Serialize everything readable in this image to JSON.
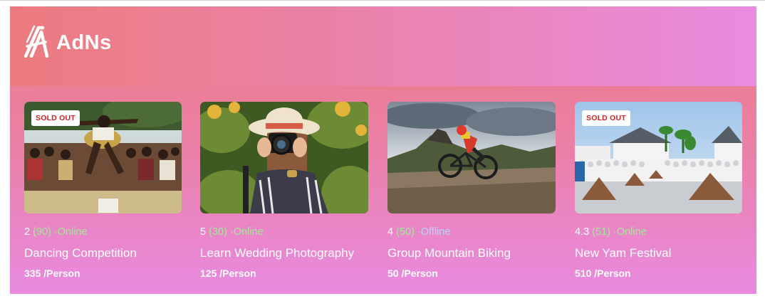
{
  "brand": {
    "name": "AdNs",
    "logo_icon": "a-logo-icon"
  },
  "badge_text": "SOLD OUT",
  "cards": [
    {
      "rating": "2",
      "count": "(90)",
      "status": "·Online",
      "title": "Dancing Competition",
      "price": "335 /Person",
      "sold_out": true,
      "image": "traditional-dancer-photo"
    },
    {
      "rating": "5",
      "count": "(30)",
      "status": "·Online",
      "title": "Learn Wedding Photography",
      "price": "125 /Person",
      "sold_out": false,
      "image": "photographer-camera-photo"
    },
    {
      "rating": "4",
      "count": "(50)",
      "status": "·Offline",
      "title": "Group Mountain Biking",
      "price": "50 /Person",
      "sold_out": false,
      "image": "mountain-biker-photo"
    },
    {
      "rating": "4.3",
      "count": "(51)",
      "status": "·Online",
      "title": "New Yam Festival",
      "price": "510 /Person",
      "sold_out": true,
      "image": "yam-festival-photo"
    }
  ],
  "colors": {
    "online": "#9eec95",
    "offline": "#b9d3f7",
    "sold_out_text": "#d02020"
  }
}
